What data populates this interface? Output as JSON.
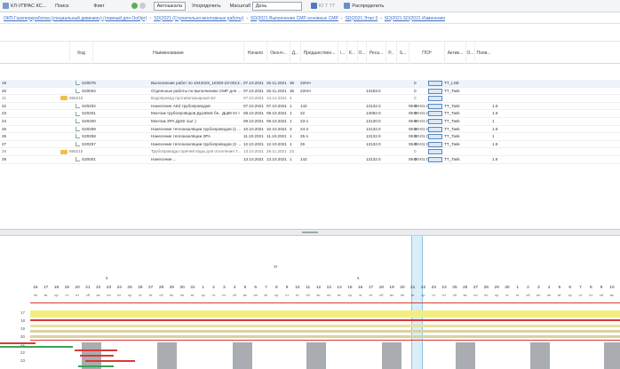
{
  "toolbar": {
    "project": "КЛ-УПРАС КС...",
    "view": "Поиск",
    "filter": "Фикт",
    "auto_label": "Автошкала",
    "sort_label": "Упорядочить",
    "scale_label": "Масштаб",
    "scale_value": "День",
    "zoom_text": "Ю Т ТТ",
    "reports_label": "Распределить"
  },
  "breadcrumbs": [
    "ОКП-Газопереработка (специальный дивизион) (главный для ОоОрт)",
    "SD(2021 (Строительно-монтажные работы)",
    "SD(2021 Выполнение СМР основных СМР",
    "SD(2021 Этап 3",
    "SD(2021 SD(2021 Изменения"
  ],
  "columns": [
    "Код",
    "Наименование",
    "Начало",
    "Оконч...",
    "Д...",
    "Предшествен...",
    "\\...",
    "К...",
    "О...",
    "Реса...",
    "Р...",
    "S...",
    "ПСР",
    "Актив...",
    "О...",
    "Поев..."
  ],
  "rows": [
    {
      "n": "19",
      "code": "S20076",
      "name": "Выполнение работ по 1042019_10330-23-0013...",
      "start": "07.10.2021",
      "end": "25.11.2021",
      "dur": "35",
      "pred": "22HH",
      "q": "0",
      "res": "",
      "psr": "",
      "act": "TT_LSE",
      "v": "",
      "kind": "leaf"
    },
    {
      "n": "20",
      "code": "S20004",
      "name": "Отдельные работы по выполнению СМР для ...",
      "start": "07.10.2021",
      "end": "25.11.2021",
      "dur": "35",
      "pred": "22HH",
      "q": "0",
      "res": "13183.0",
      "psr": "",
      "act": "TT_Task",
      "v": "",
      "kind": "leaf"
    },
    {
      "n": "21",
      "code": "885210",
      "name": "Водопровод противопожарный В2",
      "start": "07.10.2021",
      "end": "13.12.2021",
      "dur": "4",
      "pred": "",
      "q": "0",
      "res": "",
      "psr": "",
      "act": "",
      "v": "",
      "kind": "folder"
    },
    {
      "n": "22",
      "code": "S20202",
      "name": "Нанесение АКЗ трубопроводов",
      "start": "07.10.2021",
      "end": "07.10.2021",
      "dur": "1",
      "pred": "142",
      "q": "0",
      "res": "13132.0",
      "psr": "06-00-01 С03",
      "act": "TT_Task",
      "v": "1.6",
      "kind": "leaf"
    },
    {
      "n": "23",
      "code": "S20201",
      "name": "Монтаж трубопроводов Дц159х5 бн.. Дц89 5ч I",
      "start": "08.10.2021",
      "end": "09.10.2021",
      "dur": "1",
      "pred": "22",
      "q": "0",
      "res": "13092.0",
      "psr": "06-00-01 С03",
      "act": "TT_Task",
      "v": "1.6",
      "kind": "leaf"
    },
    {
      "n": "24",
      "code": "S20200",
      "name": "Монтаж ЗРА Ду50 1шт )",
      "start": "09.10.2021",
      "end": "09.10.2021",
      "dur": "1",
      "pred": "23-1",
      "q": "0",
      "res": "13130.0",
      "psr": "06-00-01 С03",
      "act": "TT_Task",
      "v": "1",
      "kind": "leaf"
    },
    {
      "n": "25",
      "code": "S20259",
      "name": "Нанесение теплоизоляции трубопроводов (1 ...",
      "start": "10.10.2021",
      "end": "10.10.2021",
      "dur": "3",
      "pred": "24-2",
      "q": "0",
      "res": "13132.0",
      "psr": "06-00-01 С03",
      "act": "TT_Task",
      "v": "1.6",
      "kind": "leaf"
    },
    {
      "n": "26",
      "code": "S20258",
      "name": "Нанесение теплоизоляции ЗРА",
      "start": "11.10.2021",
      "end": "11.10.2021",
      "dur": "1",
      "pred": "25-1",
      "q": "0",
      "res": "13132.0",
      "psr": "06-00-01 С03",
      "act": "TT_Task",
      "v": "1",
      "kind": "leaf"
    },
    {
      "n": "27",
      "code": "S20257",
      "name": "Нанесение теплоизоляции трубопроводов (2 ...",
      "start": "12.10.2021",
      "end": "12.10.2021",
      "dur": "1",
      "pred": "26",
      "q": "0",
      "res": "13132.0",
      "psr": "06-00-01 С03",
      "act": "TT_Task",
      "v": "1.6",
      "kind": "leaf"
    },
    {
      "n": "28",
      "code": "885210",
      "name": "Трубопроводы горячей воды для отопления Т...",
      "start": "13.10.2021",
      "end": "29.11.2021",
      "dur": "23",
      "pred": "",
      "q": "0",
      "res": "",
      "psr": "",
      "act": "",
      "v": "",
      "kind": "folder"
    },
    {
      "n": "29",
      "code": "S20001",
      "name": "Нанесение ...",
      "start": "13.10.2021",
      "end": "13.10.2021",
      "dur": "1",
      "pred": "142",
      "q": "0",
      "res": "13132.0",
      "psr": "06-00-01 С03",
      "act": "TT_Task",
      "v": "1.6",
      "kind": "leaf"
    }
  ],
  "gantt": {
    "month_marker": "XI",
    "week_markers": [
      "5",
      "6"
    ],
    "days": [
      "16",
      "17",
      "18",
      "19",
      "20",
      "21",
      "22",
      "23",
      "24",
      "25",
      "26",
      "27",
      "28",
      "29",
      "30",
      "31",
      "1",
      "2",
      "3",
      "4",
      "5",
      "6",
      "7",
      "8",
      "9",
      "10",
      "11",
      "12",
      "13",
      "14",
      "15",
      "16",
      "17",
      "18",
      "19",
      "20",
      "21",
      "22",
      "23",
      "24",
      "25",
      "26",
      "27",
      "28",
      "29",
      "30",
      "1",
      "2",
      "3",
      "4",
      "5",
      "6",
      "7",
      "8",
      "9",
      "10"
    ],
    "weekdays": [
      "пн",
      "вт",
      "ср",
      "чт",
      "пт",
      "сб",
      "вс",
      "пн",
      "вт",
      "ср",
      "чт",
      "пт",
      "сб",
      "вс",
      "пн",
      "вт",
      "ср",
      "чт",
      "пт",
      "сб",
      "вс",
      "пн",
      "вт",
      "ср",
      "чт",
      "пт",
      "сб",
      "вс",
      "пн",
      "вт",
      "ср",
      "чт",
      "пт",
      "сб",
      "вс",
      "пн",
      "вт",
      "ср",
      "чт",
      "пт",
      "сб",
      "вс",
      "пн",
      "вт",
      "ср",
      "чт",
      "пт",
      "сб",
      "вс",
      "пн",
      "вт",
      "ср",
      "чт",
      "пт",
      "сб",
      "вс"
    ],
    "lane_numbers": [
      "17",
      "18",
      "19",
      "20",
      "21",
      "22",
      "23"
    ]
  },
  "colors": {
    "accent": "#3b6cc4",
    "today": "#8cc6e6",
    "weekend": "#a9acb0",
    "bar_yellow": "#f3ee84",
    "bar_red": "#d73a36",
    "bar_green": "#3aa357"
  }
}
